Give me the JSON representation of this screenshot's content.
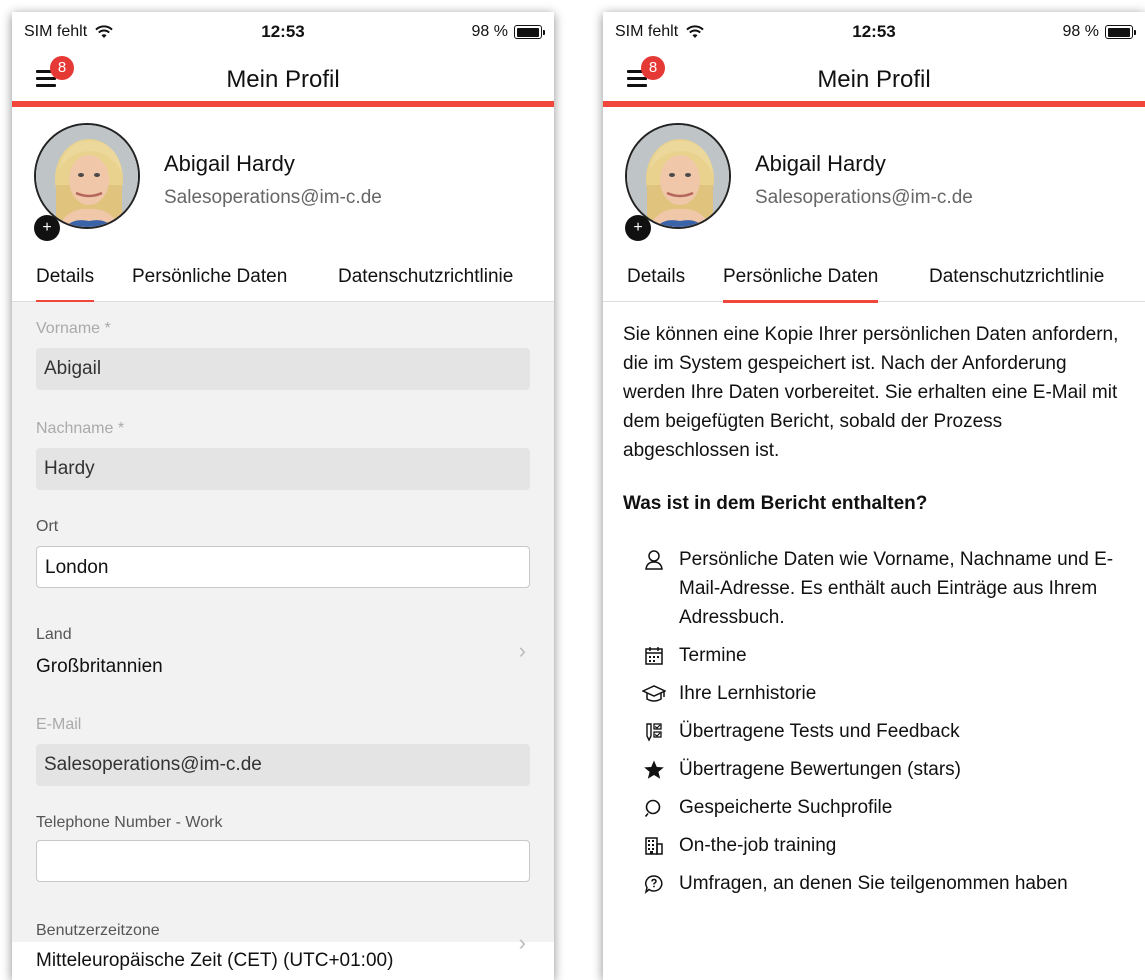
{
  "statusbar": {
    "carrier": "SIM fehlt",
    "time": "12:53",
    "battery": "98 %",
    "battery_level": 0.98
  },
  "nav": {
    "title": "Mein Profil",
    "badge": "8"
  },
  "profile": {
    "name": "Abigail Hardy",
    "email": "Salesoperations@im-c.de",
    "add": "+"
  },
  "tabs": [
    "Details",
    "Persönliche Daten",
    "Datenschutzrichtlinie"
  ],
  "details": {
    "firstname": {
      "label": "Vorname *",
      "value": "Abigail"
    },
    "lastname": {
      "label": "Nachname *",
      "value": "Hardy"
    },
    "city": {
      "label": "Ort",
      "value": "London"
    },
    "country": {
      "label": "Land",
      "value": "Großbritannien"
    },
    "email": {
      "label": "E-Mail",
      "value": "Salesoperations@im-c.de"
    },
    "phone": {
      "label": "Telephone Number - Work",
      "value": ""
    },
    "timezone": {
      "label": "Benutzerzeitzone",
      "value": "Mitteleuropäische Zeit (CET) (UTC+01:00)"
    }
  },
  "personal": {
    "intro": "Sie können eine Kopie Ihrer persönlichen Daten anfordern, die im System gespeichert ist. Nach der Anforderung werden Ihre Daten vorbereitet. Sie erhalten eine E-Mail mit dem beigefügten Bericht, sobald der Prozess abgeschlossen ist.",
    "heading": "Was ist in dem Bericht enthalten?",
    "items": [
      {
        "icon": "person-icon",
        "text": "Persönliche Daten wie Vorname, Nachname und E-Mail-Adresse. Es enthält auch Einträge aus Ihrem Adressbuch."
      },
      {
        "icon": "calendar-icon",
        "text": "Termine"
      },
      {
        "icon": "graduation-cap-icon",
        "text": "Ihre Lernhistorie"
      },
      {
        "icon": "test-checklist-icon",
        "text": "Übertragene Tests und Feedback"
      },
      {
        "icon": "star-icon",
        "text": "Übertragene Bewertungen (stars)"
      },
      {
        "icon": "search-icon",
        "text": "Gespeicherte Suchprofile"
      },
      {
        "icon": "building-icon",
        "text": "On-the-job training"
      },
      {
        "icon": "survey-bubble-icon",
        "text": "Umfragen, an denen Sie teilgenommen haben"
      }
    ]
  }
}
